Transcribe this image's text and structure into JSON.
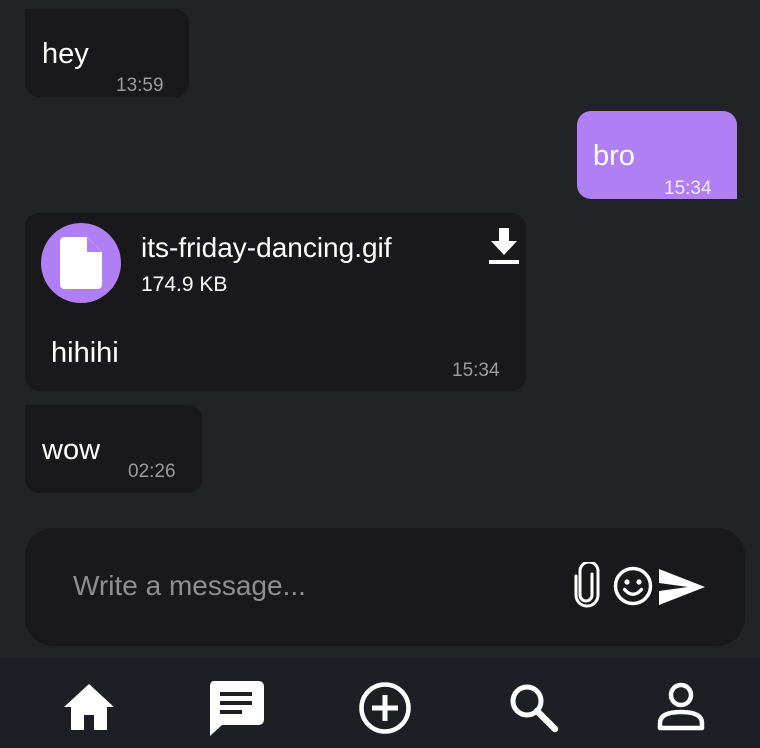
{
  "messages": [
    {
      "direction": "incoming",
      "text": "hey",
      "time": "13:59"
    },
    {
      "direction": "outgoing",
      "text": "bro",
      "time": "15:34"
    },
    {
      "direction": "incoming",
      "attachment": {
        "file_name": "its-friday-dancing.gif",
        "file_size": "174.9 KB",
        "icon": "file-icon",
        "action_icon": "download-icon"
      },
      "text": "hihihi",
      "time": "15:34"
    },
    {
      "direction": "incoming",
      "text": "wow",
      "time": "02:26"
    }
  ],
  "composer": {
    "value": "",
    "placeholder": "Write a message...",
    "icons": [
      "paperclip-icon",
      "emoji-icon",
      "send-icon"
    ]
  },
  "bottom_nav": {
    "items": [
      {
        "name": "home",
        "icon": "home-icon"
      },
      {
        "name": "chats",
        "icon": "chat-icon",
        "active": true
      },
      {
        "name": "new",
        "icon": "add-circle-icon"
      },
      {
        "name": "search",
        "icon": "search-icon"
      },
      {
        "name": "profile",
        "icon": "profile-icon"
      }
    ]
  },
  "colors": {
    "background": "#222327",
    "incoming_bubble": "#19191b",
    "outgoing_bubble": "#b07ff3",
    "accent": "#b07ff3",
    "nav_background": "#1d1f25",
    "secondary_text": "#9a9aa0"
  }
}
